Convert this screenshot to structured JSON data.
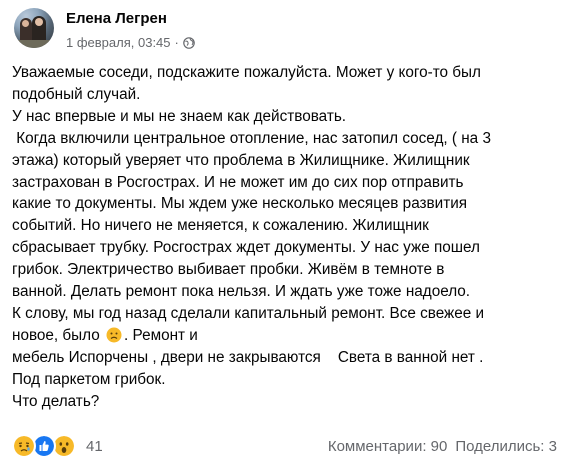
{
  "post": {
    "author": "Елена Легрен",
    "timestamp": "1 февраля, 03:45",
    "separator": "·",
    "privacy_icon": "globe-icon",
    "body_lines": [
      "Уважаемые соседи, подскажите пожалуйста. Может у кого-то был",
      "подобный случай.",
      "У нас впервые и мы не знаем как действовать.",
      " Когда включили центральное отопление, нас затопил сосед, ( на 3",
      "этажа) который уверяет что проблема в Жилищнике. Жилищник",
      "застрахован в Росгострах. И не может им до сих пор отправить",
      "какие то документы. Мы ждем уже несколько месяцев развития",
      "событий. Но ничего не меняется, к сожалению. Жилищник",
      "сбрасывает трубку. Росгострах ждет документы. У нас уже пошел",
      "грибок. Электричество выбивает пробки. Живём в темноте в",
      "ванной. Делать ремонт пока нельзя. И ждать уже тоже надоело.",
      "К слову, мы год назад сделали капитальный ремонт. Все свежее и"
    ],
    "line_with_emoji": {
      "before": "новое, было ",
      "emoji": "sad-face-emoji",
      "after": ". Ремонт и"
    },
    "body_lines_after": [
      "мебель Испорчены , двери не закрываются    Света в ванной нет .",
      "Под паркетом грибок.",
      "Что делать?"
    ]
  },
  "reactions": {
    "icons": [
      "sad-reaction-icon",
      "like-reaction-icon",
      "wow-reaction-icon"
    ],
    "count": "41",
    "comments": "Комментарии: 90",
    "shares": "Поделились: 3"
  },
  "colors": {
    "text": "#050505",
    "secondary": "#65676b",
    "like_blue": "#1877f2",
    "emoji_yellow": "#f7b928"
  }
}
